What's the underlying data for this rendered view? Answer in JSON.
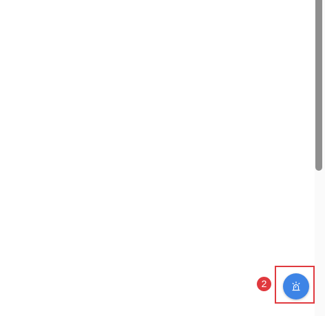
{
  "page": {
    "background": "#ffffff"
  },
  "scrollbar": {
    "thumb_color": "#8f8f8f"
  },
  "fab": {
    "icon": "alarm-siren-icon",
    "color": "#3d84e6"
  },
  "highlight": {
    "color": "#e0393e"
  },
  "badge": {
    "label": "2",
    "color": "#e0393e"
  }
}
